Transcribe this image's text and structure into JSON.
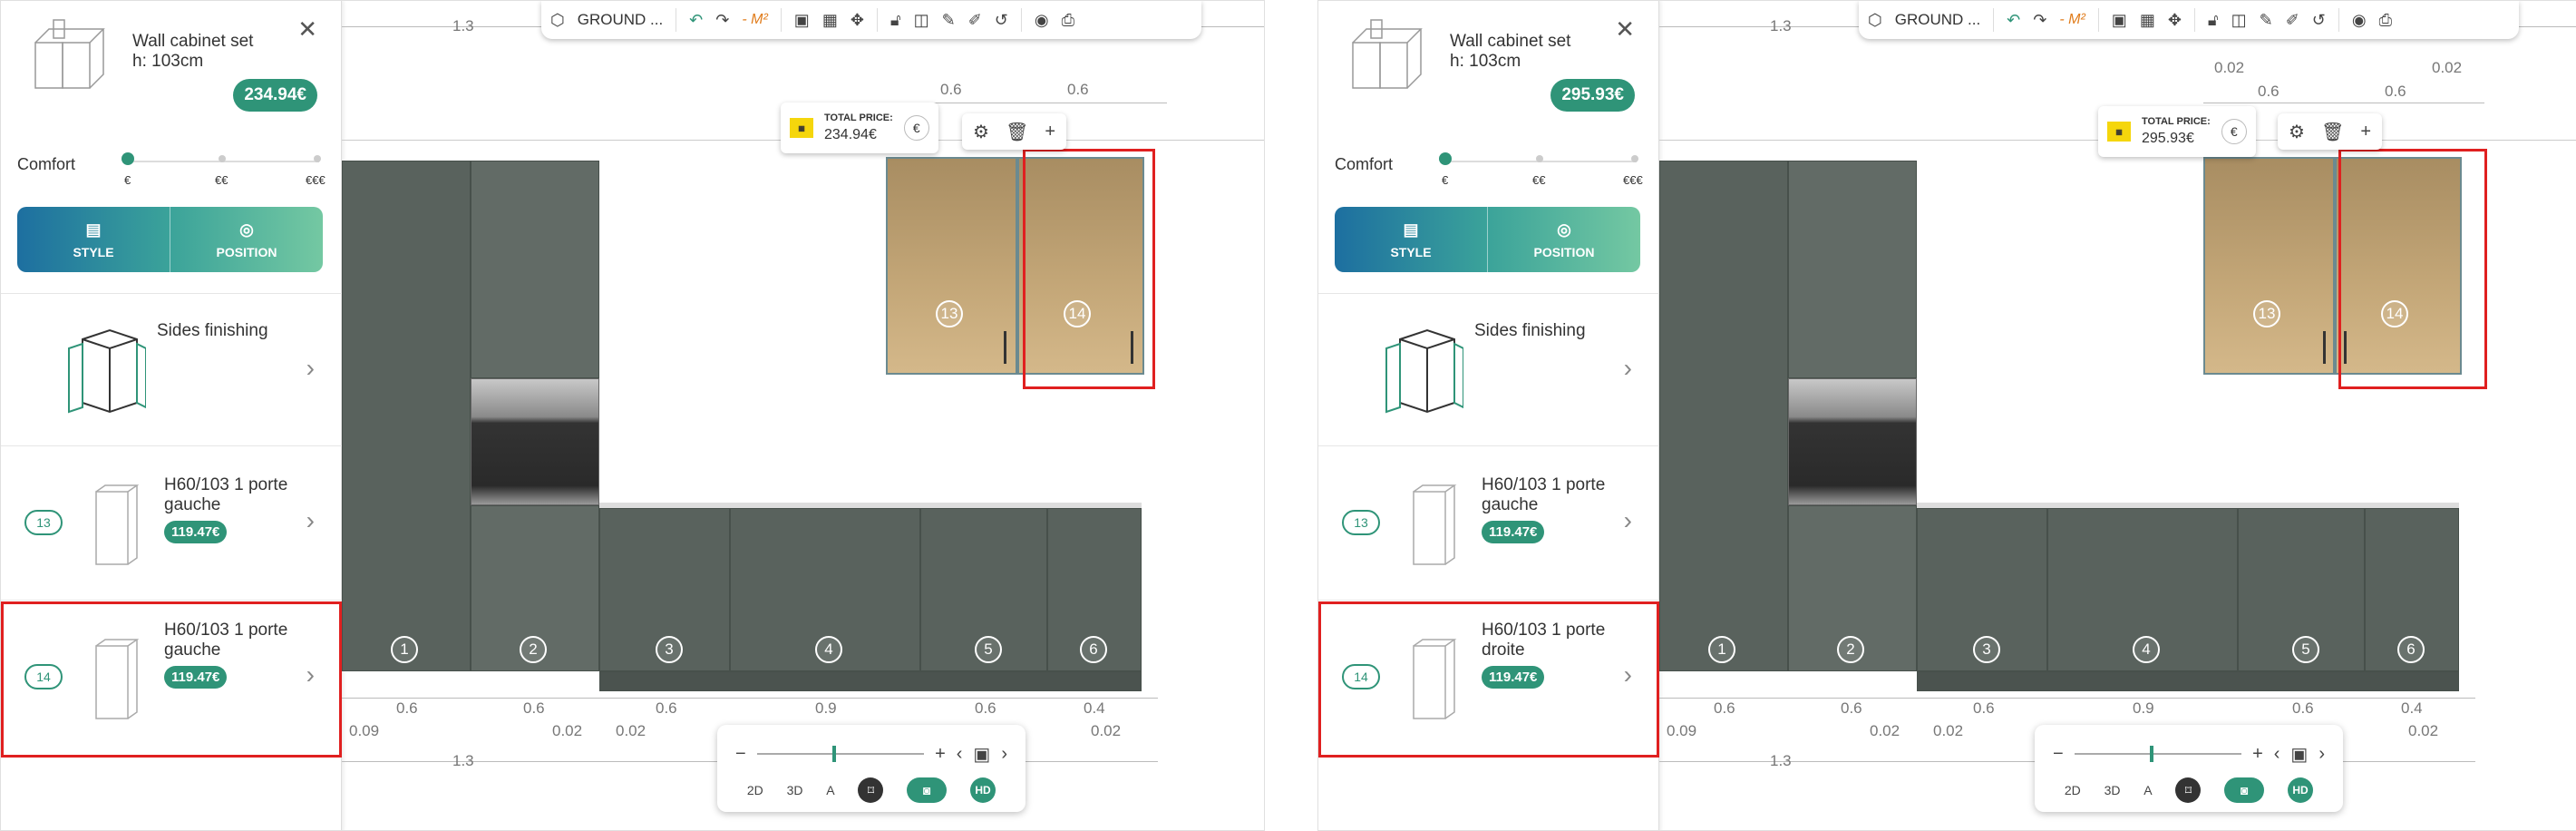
{
  "panels": [
    {
      "sidebar": {
        "title_line1": "Wall cabinet set",
        "title_line2": "h: 103cm",
        "price": "234.94€",
        "comfort_label": "Comfort",
        "comfort_ticks": [
          "€",
          "€€",
          "€€€"
        ],
        "comfort_level": 1,
        "tabs": [
          {
            "label": "STYLE"
          },
          {
            "label": "POSITION"
          }
        ],
        "sides_label": "Sides finishing",
        "items": [
          {
            "badge": "13",
            "name": "H60/103 1 porte gauche",
            "price": "119.47€"
          },
          {
            "badge": "14",
            "name": "H60/103 1 porte gauche",
            "price": "119.47€"
          }
        ]
      },
      "toolbar": {
        "level": "GROUND ...",
        "m2": "- M²"
      },
      "price_popup": {
        "label": "TOTAL PRICE:",
        "value": "234.94€",
        "currency": "€"
      },
      "action_popup": {
        "add": "+"
      },
      "dims": {
        "top_overall": "1.3",
        "upper_a": "0.6",
        "upper_b": "0.6",
        "bottom_row": [
          "0.6",
          "0.6",
          "0.6",
          "0.9",
          "0.6",
          "0.4"
        ],
        "small": [
          "0.09",
          "0.02",
          "0.02",
          "0.02"
        ],
        "bottom_overall": "1.3"
      },
      "cabinets": [
        "1",
        "2",
        "3",
        "4",
        "5",
        "6",
        "13",
        "14"
      ],
      "bottombar": {
        "minus": "−",
        "plus": "+",
        "m2d": "2D",
        "m3d": "3D",
        "hd": "HD"
      }
    },
    {
      "sidebar": {
        "title_line1": "Wall cabinet set",
        "title_line2": "h: 103cm",
        "price": "295.93€",
        "comfort_label": "Comfort",
        "comfort_ticks": [
          "€",
          "€€",
          "€€€"
        ],
        "comfort_level": 1,
        "tabs": [
          {
            "label": "STYLE"
          },
          {
            "label": "POSITION"
          }
        ],
        "sides_label": "Sides finishing",
        "items": [
          {
            "badge": "13",
            "name": "H60/103 1 porte gauche",
            "price": "119.47€"
          },
          {
            "badge": "14",
            "name": "H60/103 1 porte droite",
            "price": "119.47€"
          }
        ]
      },
      "toolbar": {
        "level": "GROUND ...",
        "m2": "- M²"
      },
      "price_popup": {
        "label": "TOTAL PRICE:",
        "value": "295.93€",
        "currency": "€"
      },
      "action_popup": {
        "add": "+"
      },
      "dims": {
        "top_overall": "1.3",
        "upper_a": "0.6",
        "upper_b": "0.6",
        "upper_small_a": "0.02",
        "upper_small_b": "0.02",
        "bottom_row": [
          "0.6",
          "0.6",
          "0.6",
          "0.9",
          "0.6",
          "0.4"
        ],
        "small": [
          "0.09",
          "0.02",
          "0.02",
          "0.02"
        ],
        "bottom_overall": "1.3"
      },
      "cabinets": [
        "1",
        "2",
        "3",
        "4",
        "5",
        "6",
        "13",
        "14"
      ],
      "bottombar": {
        "minus": "−",
        "plus": "+",
        "m2d": "2D",
        "m3d": "3D",
        "hd": "HD"
      }
    }
  ]
}
